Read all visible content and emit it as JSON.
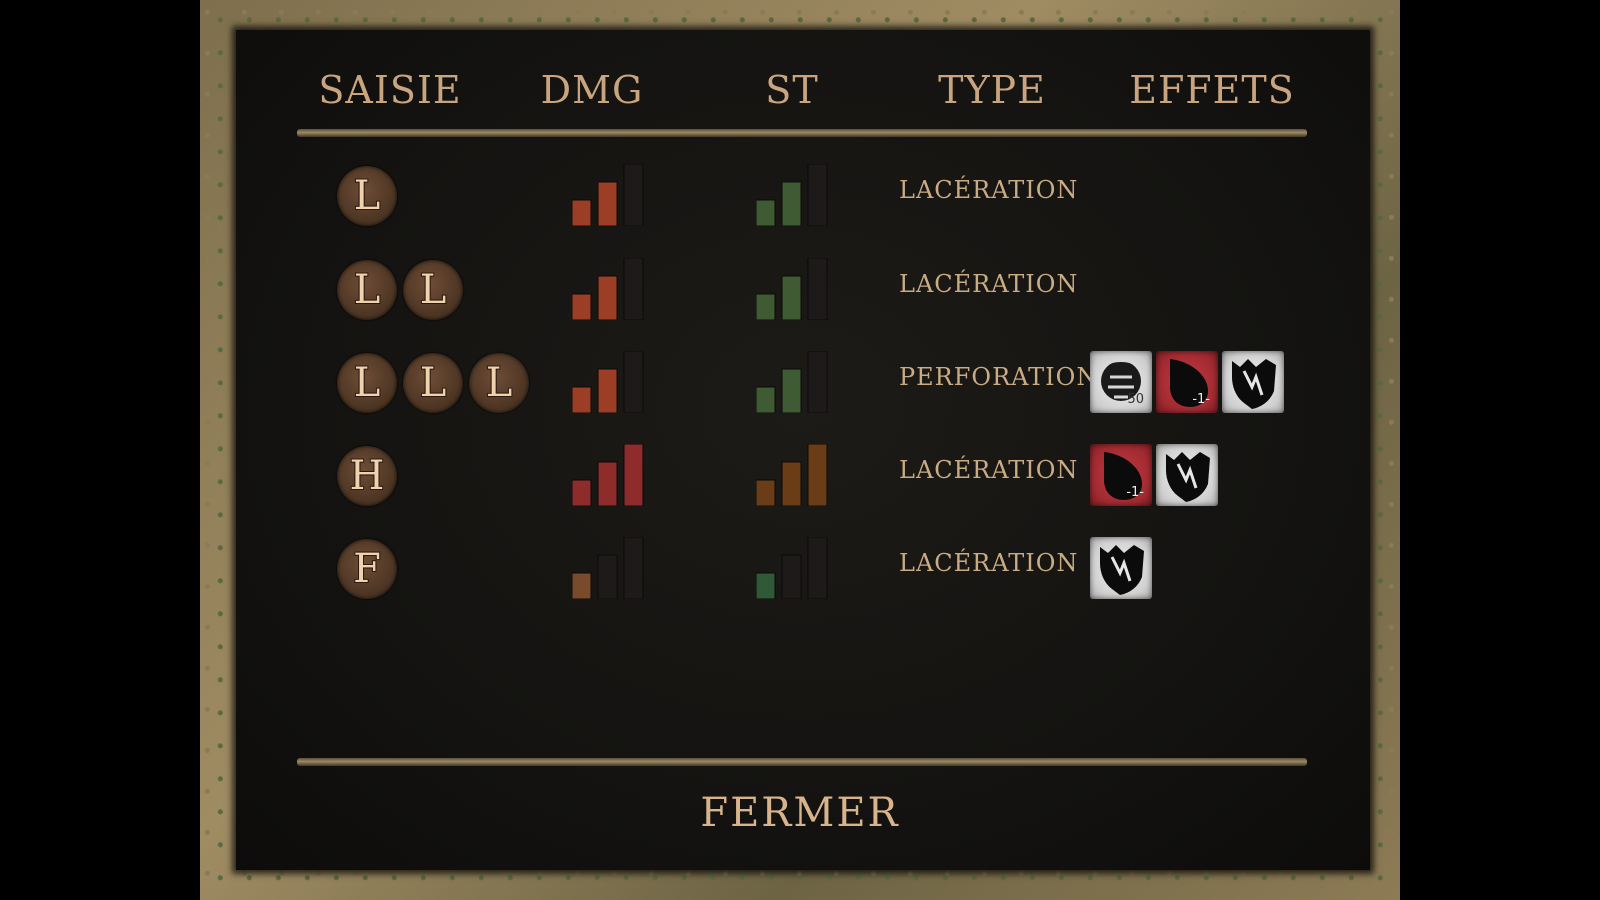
{
  "headers": [
    "SAISIE",
    "DMG",
    "ST",
    "TYPE",
    "EFFETS"
  ],
  "rows": [
    {
      "grips": [
        "L"
      ],
      "dmg_level": 2,
      "dmg_color": "#9c3e26",
      "st_level": 2,
      "st_color": "#3e5b33",
      "type": "LACÉRATION",
      "effects": []
    },
    {
      "grips": [
        "L",
        "L"
      ],
      "dmg_level": 2,
      "dmg_color": "#9c3e26",
      "st_level": 2,
      "st_color": "#3e5b33",
      "type": "LACÉRATION",
      "effects": []
    },
    {
      "grips": [
        "L",
        "L",
        "L"
      ],
      "dmg_level": 2,
      "dmg_color": "#9c3e26",
      "st_level": 2,
      "st_color": "#3e5b33",
      "type": "PERFORATION",
      "effects": [
        {
          "icon": "armor-pierce-icon",
          "style": "white",
          "value": "50"
        },
        {
          "icon": "bleed-icon",
          "style": "red",
          "value": "-1-"
        },
        {
          "icon": "stagger-icon",
          "style": "white",
          "value": ""
        }
      ]
    },
    {
      "grips": [
        "H"
      ],
      "dmg_level": 3,
      "dmg_color": "#8e2b2b",
      "st_level": 3,
      "st_color": "#6a3d16",
      "type": "LACÉRATION",
      "effects": [
        {
          "icon": "bleed-icon",
          "style": "red",
          "value": "-1-"
        },
        {
          "icon": "stagger-icon",
          "style": "white",
          "value": ""
        }
      ]
    },
    {
      "grips": [
        "F"
      ],
      "dmg_level": 1,
      "dmg_color": "#7a4a2c",
      "st_level": 1,
      "st_color": "#2f5a35",
      "type": "LACÉRATION",
      "effects": [
        {
          "icon": "stagger-icon",
          "style": "white",
          "value": ""
        }
      ]
    }
  ],
  "close_label": "FERMER"
}
